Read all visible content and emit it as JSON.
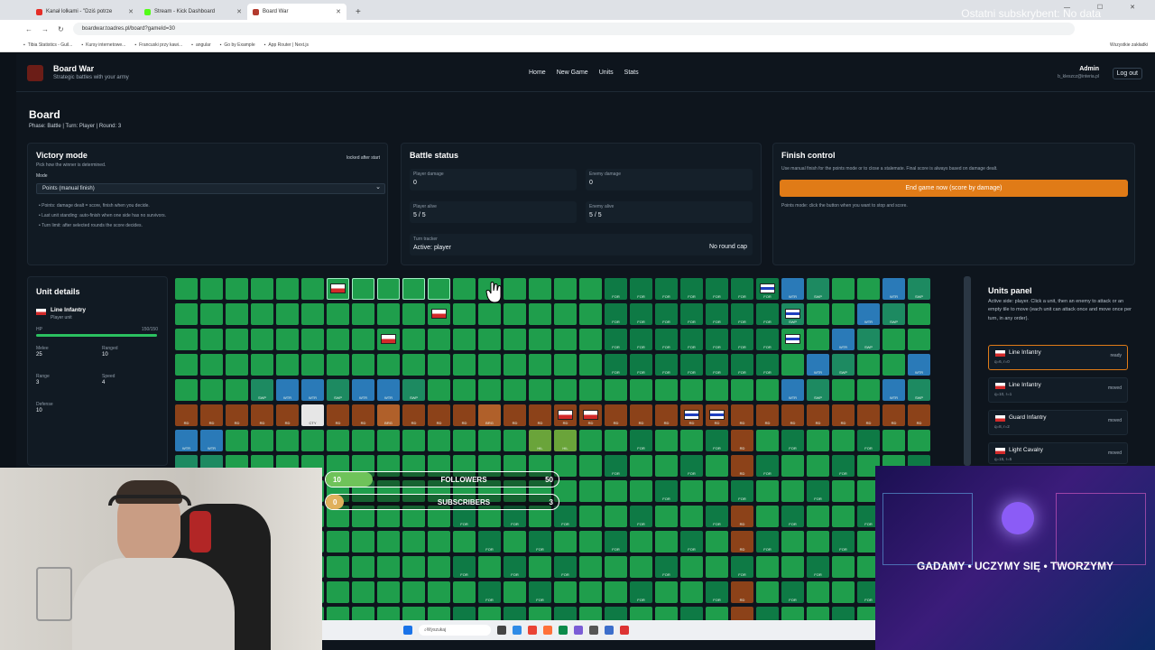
{
  "browser": {
    "tabs": [
      {
        "title": "Kanał lolkami - \"Dziś potrze",
        "color": "#e52d27"
      },
      {
        "title": "Stream - Kick Dashboard",
        "color": "#53fc18"
      },
      {
        "title": "Board War",
        "color": "#b33a2e"
      }
    ],
    "new_tab": "+",
    "watermark": "Ostatni subskrybent: No data",
    "url": "boardwar.toadres.pl/board?gameId=30",
    "bookmarks": [
      "Tibia Statistics - Guil...",
      "Kursy internetowe...",
      "Francuski przy kawi...",
      "angular",
      "Go by Example",
      "App Router | Next.js"
    ],
    "bookmarks_right": "Wszystkie zakładki"
  },
  "app": {
    "brand": "Board War",
    "tagline": "Strategic battles with your army",
    "nav": [
      "Home",
      "New Game",
      "Units",
      "Stats"
    ],
    "user_name": "Admin",
    "user_email": "b_kleszcz@interia.pl",
    "logout": "Log out",
    "page_title": "Board",
    "phase_line": "Phase: Battle | Turn: Player | Round: 3"
  },
  "victory": {
    "title": "Victory mode",
    "subtitle": "Pick how the winner is determined.",
    "locked": "locked after start",
    "mode_label": "Mode",
    "mode_value": "Points (manual finish)",
    "bullets": [
      "Points: damage dealt = score, finish when you decide.",
      "Last unit standing: auto-finish when one side has no survivors.",
      "Turn limit: after selected rounds the score decides."
    ]
  },
  "battle": {
    "title": "Battle status",
    "player_damage_label": "Player damage",
    "player_damage": "0",
    "enemy_damage_label": "Enemy damage",
    "enemy_damage": "0",
    "player_alive_label": "Player alive",
    "player_alive": "5 / 5",
    "enemy_alive_label": "Enemy alive",
    "enemy_alive": "5 / 5",
    "turn_label": "Turn tracker",
    "turn_value": "Active: player",
    "round_cap": "No round cap"
  },
  "finish": {
    "title": "Finish control",
    "desc": "Use manual finish for the points mode or to close a stalemate. Final score is always based on damage dealt.",
    "button": "End game now (score by damage)",
    "note": "Points mode: click the button when you want to stop and score."
  },
  "unit_details": {
    "title": "Unit details",
    "name": "Line Infantry",
    "owner": "Player unit",
    "hp_label": "HP",
    "hp": "150/150",
    "hp_fraction": 1.0,
    "melee_label": "Melee",
    "melee": "25",
    "ranged_label": "Ranged",
    "ranged": "10",
    "range_label": "Range",
    "range": "3",
    "speed_label": "Speed",
    "speed": "4",
    "defense_label": "Defense",
    "defense": "10"
  },
  "units_panel": {
    "title": "Units panel",
    "desc": "Active side: player. Click a unit, then an enemy to attack or an empty tile to move (each unit can attack once and move once per turn, in any order).",
    "units": [
      {
        "name": "Line Infantry",
        "sub": "q=6, r=0",
        "status": "ready"
      },
      {
        "name": "Line Infantry",
        "sub": "q=10, r=1",
        "status": "moved"
      },
      {
        "name": "Guard Infantry",
        "sub": "q=8, r=2",
        "status": "moved"
      },
      {
        "name": "Light Cavalry",
        "sub": "q=15, r=5",
        "status": "moved"
      }
    ]
  },
  "terrain_labels": {
    "FOR": "FOR",
    "SWP": "SWP",
    "WTR": "WTR",
    "RD": "RD",
    "CTY": "CTY",
    "HIL": "HIL",
    "BRG": "BRG"
  },
  "overlay": {
    "followers_label": "FOLLOWERS",
    "followers_current": "10",
    "followers_goal": "50",
    "subs_label": "SUBSCRIBERS",
    "subs_current": "0",
    "subs_goal": "3"
  },
  "promo": {
    "text": "GADAMY • UCZYMY SIĘ • TWORZYMY"
  },
  "taskbar": {
    "search": "Wyszukaj"
  },
  "colors": {
    "grass": "#1f9e4c",
    "forest": "#0e7a45",
    "swamp": "#1d8a61",
    "water": "#2a7ab8",
    "road": "#8c4219",
    "city": "#e6e6e6",
    "hill": "#6aa43a",
    "accent": "#e07b17"
  }
}
